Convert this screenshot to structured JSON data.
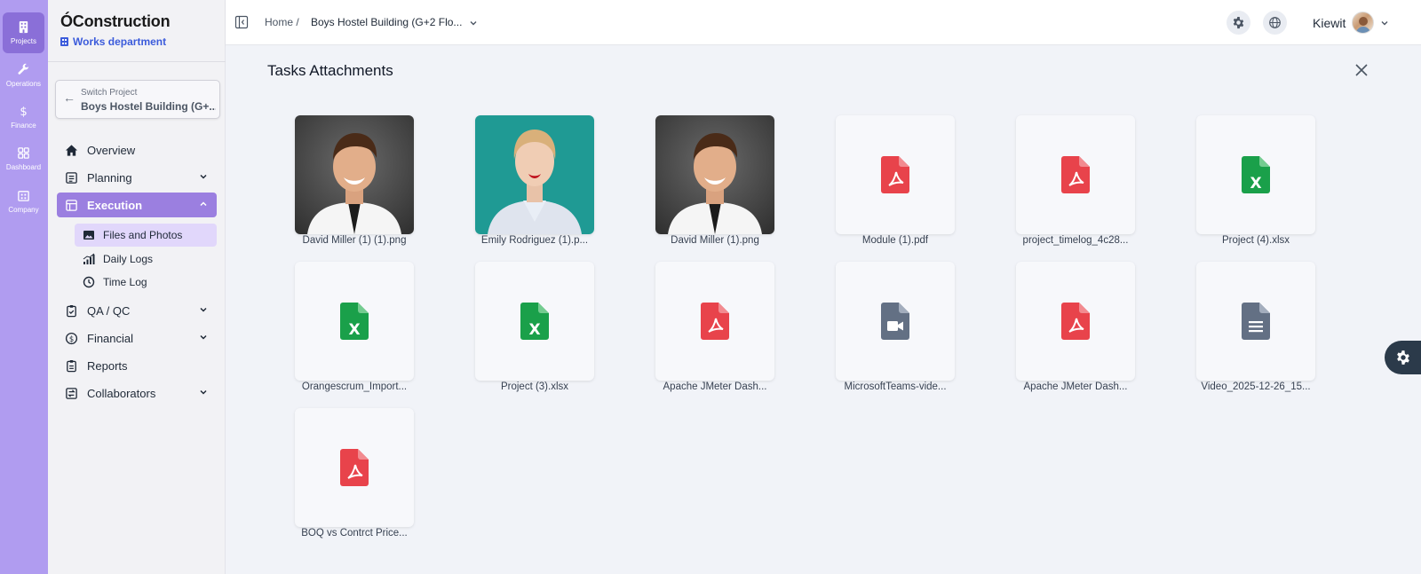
{
  "rail": {
    "items": [
      {
        "label": "Projects",
        "icon": "building-icon",
        "active": true
      },
      {
        "label": "Operations",
        "icon": "wrench-icon"
      },
      {
        "label": "Finance",
        "icon": "dollar-icon"
      },
      {
        "label": "Dashboard",
        "icon": "grid-icon"
      },
      {
        "label": "Company",
        "icon": "company-icon"
      }
    ]
  },
  "sidebar": {
    "brand": "ÓConstruction",
    "department": "Works department",
    "switch_label": "Switch Project",
    "switch_value": "Boys Hostel Building (G+...",
    "nav": [
      {
        "label": "Overview",
        "icon": "home-icon"
      },
      {
        "label": "Planning",
        "icon": "planning-icon"
      },
      {
        "label": "Execution",
        "icon": "execution-icon",
        "active": true
      },
      {
        "label": "QA / QC",
        "icon": "clipboard-check-icon"
      },
      {
        "label": "Financial",
        "icon": "dollar-circle-icon"
      },
      {
        "label": "Reports",
        "icon": "reports-icon"
      },
      {
        "label": "Collaborators",
        "icon": "collaborators-icon"
      }
    ],
    "execution_sub": [
      {
        "label": "Files and Photos",
        "icon": "image-icon",
        "active": true
      },
      {
        "label": "Daily Logs",
        "icon": "signal-chart-icon"
      },
      {
        "label": "Time Log",
        "icon": "clock-icon"
      }
    ]
  },
  "header": {
    "home": "Home /",
    "project": "Boys Hostel Building (G+2 Flo...",
    "user": "Kiewit"
  },
  "main": {
    "title": "Tasks Attachments",
    "files": [
      {
        "name": "David Miller (1) (1).png",
        "type": "photo-man"
      },
      {
        "name": "Emily Rodriguez (1).p...",
        "type": "photo-woman"
      },
      {
        "name": "David Miller (1).png",
        "type": "photo-man"
      },
      {
        "name": "Module (1).pdf",
        "type": "pdf"
      },
      {
        "name": "project_timelog_4c28...",
        "type": "pdf"
      },
      {
        "name": "Project (4).xlsx",
        "type": "excel"
      },
      {
        "name": "Orangescrum_Import...",
        "type": "excel"
      },
      {
        "name": "Project (3).xlsx",
        "type": "excel"
      },
      {
        "name": "Apache JMeter Dash...",
        "type": "pdf"
      },
      {
        "name": "MicrosoftTeams-vide...",
        "type": "video"
      },
      {
        "name": "Apache JMeter Dash...",
        "type": "pdf"
      },
      {
        "name": "Video_2025-12-26_15...",
        "type": "document"
      },
      {
        "name": "BOQ vs Contrct Price...",
        "type": "pdf"
      }
    ]
  },
  "colors": {
    "rail": "#b09cf0",
    "accent": "#9b7fe0",
    "pdf": "#e8434b",
    "excel": "#1aa04a",
    "neutral_file": "#637084"
  }
}
